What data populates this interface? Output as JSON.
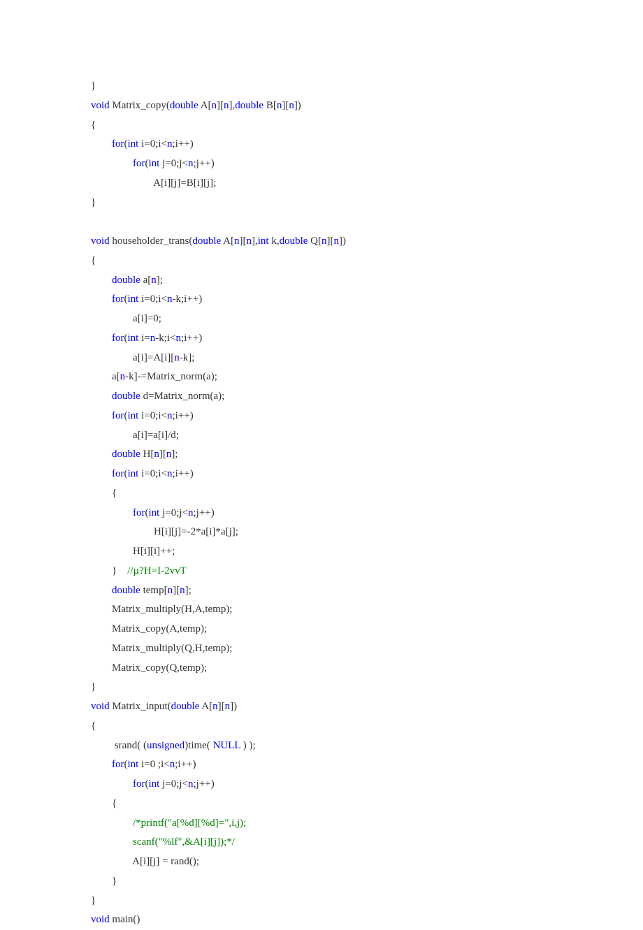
{
  "lines": [
    [
      {
        "c": "plain",
        "t": "}"
      }
    ],
    [
      {
        "c": "kw",
        "t": "void"
      },
      {
        "c": "plain",
        "t": " Matrix_copy("
      },
      {
        "c": "kw",
        "t": "double"
      },
      {
        "c": "plain",
        "t": " A["
      },
      {
        "c": "num",
        "t": "n"
      },
      {
        "c": "plain",
        "t": "]["
      },
      {
        "c": "num",
        "t": "n"
      },
      {
        "c": "plain",
        "t": "],"
      },
      {
        "c": "kw",
        "t": "double"
      },
      {
        "c": "plain",
        "t": " B["
      },
      {
        "c": "num",
        "t": "n"
      },
      {
        "c": "plain",
        "t": "]["
      },
      {
        "c": "num",
        "t": "n"
      },
      {
        "c": "plain",
        "t": "])"
      }
    ],
    [
      {
        "c": "plain",
        "t": "{"
      }
    ],
    [
      {
        "c": "plain",
        "t": "        "
      },
      {
        "c": "kw",
        "t": "for"
      },
      {
        "c": "plain",
        "t": "("
      },
      {
        "c": "kw",
        "t": "int"
      },
      {
        "c": "plain",
        "t": " i=0;i<"
      },
      {
        "c": "num",
        "t": "n"
      },
      {
        "c": "plain",
        "t": ";i++)"
      }
    ],
    [
      {
        "c": "plain",
        "t": "                "
      },
      {
        "c": "kw",
        "t": "for"
      },
      {
        "c": "plain",
        "t": "("
      },
      {
        "c": "kw",
        "t": "int"
      },
      {
        "c": "plain",
        "t": " j=0;j<"
      },
      {
        "c": "num",
        "t": "n"
      },
      {
        "c": "plain",
        "t": ";j++)"
      }
    ],
    [
      {
        "c": "plain",
        "t": "                        A[i][j]=B[i][j];"
      }
    ],
    [
      {
        "c": "plain",
        "t": "}"
      }
    ],
    [
      {
        "c": "plain",
        "t": ""
      }
    ],
    [
      {
        "c": "kw",
        "t": "void"
      },
      {
        "c": "plain",
        "t": " householder_trans("
      },
      {
        "c": "kw",
        "t": "double"
      },
      {
        "c": "plain",
        "t": " A["
      },
      {
        "c": "num",
        "t": "n"
      },
      {
        "c": "plain",
        "t": "]["
      },
      {
        "c": "num",
        "t": "n"
      },
      {
        "c": "plain",
        "t": "],"
      },
      {
        "c": "kw",
        "t": "int"
      },
      {
        "c": "plain",
        "t": " k,"
      },
      {
        "c": "kw",
        "t": "double"
      },
      {
        "c": "plain",
        "t": " Q["
      },
      {
        "c": "num",
        "t": "n"
      },
      {
        "c": "plain",
        "t": "]["
      },
      {
        "c": "num",
        "t": "n"
      },
      {
        "c": "plain",
        "t": "])"
      }
    ],
    [
      {
        "c": "plain",
        "t": "{"
      }
    ],
    [
      {
        "c": "plain",
        "t": "        "
      },
      {
        "c": "kw",
        "t": "double"
      },
      {
        "c": "plain",
        "t": " a["
      },
      {
        "c": "num",
        "t": "n"
      },
      {
        "c": "plain",
        "t": "];"
      }
    ],
    [
      {
        "c": "plain",
        "t": "        "
      },
      {
        "c": "kw",
        "t": "for"
      },
      {
        "c": "plain",
        "t": "("
      },
      {
        "c": "kw",
        "t": "int"
      },
      {
        "c": "plain",
        "t": " i=0;i<"
      },
      {
        "c": "num",
        "t": "n"
      },
      {
        "c": "plain",
        "t": "-k;i++)"
      }
    ],
    [
      {
        "c": "plain",
        "t": "                a[i]=0;"
      }
    ],
    [
      {
        "c": "plain",
        "t": "        "
      },
      {
        "c": "kw",
        "t": "for"
      },
      {
        "c": "plain",
        "t": "("
      },
      {
        "c": "kw",
        "t": "int"
      },
      {
        "c": "plain",
        "t": " i="
      },
      {
        "c": "num",
        "t": "n"
      },
      {
        "c": "plain",
        "t": "-k;i<"
      },
      {
        "c": "num",
        "t": "n"
      },
      {
        "c": "plain",
        "t": ";i++)"
      }
    ],
    [
      {
        "c": "plain",
        "t": "                a[i]=A[i]["
      },
      {
        "c": "num",
        "t": "n"
      },
      {
        "c": "plain",
        "t": "-k];"
      }
    ],
    [
      {
        "c": "plain",
        "t": "        a["
      },
      {
        "c": "num",
        "t": "n"
      },
      {
        "c": "plain",
        "t": "-k]-=Matrix_norm(a);"
      }
    ],
    [
      {
        "c": "plain",
        "t": "        "
      },
      {
        "c": "kw",
        "t": "double"
      },
      {
        "c": "plain",
        "t": " d=Matrix_norm(a);"
      }
    ],
    [
      {
        "c": "plain",
        "t": "        "
      },
      {
        "c": "kw",
        "t": "for"
      },
      {
        "c": "plain",
        "t": "("
      },
      {
        "c": "kw",
        "t": "int"
      },
      {
        "c": "plain",
        "t": " i=0;i<"
      },
      {
        "c": "num",
        "t": "n"
      },
      {
        "c": "plain",
        "t": ";i++)"
      }
    ],
    [
      {
        "c": "plain",
        "t": "                a[i]=a[i]/d;"
      }
    ],
    [
      {
        "c": "plain",
        "t": "        "
      },
      {
        "c": "kw",
        "t": "double"
      },
      {
        "c": "plain",
        "t": " H["
      },
      {
        "c": "num",
        "t": "n"
      },
      {
        "c": "plain",
        "t": "]["
      },
      {
        "c": "num",
        "t": "n"
      },
      {
        "c": "plain",
        "t": "];"
      }
    ],
    [
      {
        "c": "plain",
        "t": "        "
      },
      {
        "c": "kw",
        "t": "for"
      },
      {
        "c": "plain",
        "t": "("
      },
      {
        "c": "kw",
        "t": "int"
      },
      {
        "c": "plain",
        "t": " i=0;i<"
      },
      {
        "c": "num",
        "t": "n"
      },
      {
        "c": "plain",
        "t": ";i++)"
      }
    ],
    [
      {
        "c": "plain",
        "t": "        {"
      }
    ],
    [
      {
        "c": "plain",
        "t": "                "
      },
      {
        "c": "kw",
        "t": "for"
      },
      {
        "c": "plain",
        "t": "("
      },
      {
        "c": "kw",
        "t": "int"
      },
      {
        "c": "plain",
        "t": " j=0;j<"
      },
      {
        "c": "num",
        "t": "n"
      },
      {
        "c": "plain",
        "t": ";j++)"
      }
    ],
    [
      {
        "c": "plain",
        "t": "                        H[i][j]=-2*a[i]*a[j];"
      }
    ],
    [
      {
        "c": "plain",
        "t": "                H[i][i]++;"
      }
    ],
    [
      {
        "c": "plain",
        "t": "        }    "
      },
      {
        "c": "com",
        "t": "//µ?H=I-2vvT"
      }
    ],
    [
      {
        "c": "plain",
        "t": "        "
      },
      {
        "c": "kw",
        "t": "double"
      },
      {
        "c": "plain",
        "t": " temp["
      },
      {
        "c": "num",
        "t": "n"
      },
      {
        "c": "plain",
        "t": "]["
      },
      {
        "c": "num",
        "t": "n"
      },
      {
        "c": "plain",
        "t": "];"
      }
    ],
    [
      {
        "c": "plain",
        "t": "        Matrix_multiply(H,A,temp);"
      }
    ],
    [
      {
        "c": "plain",
        "t": "        Matrix_copy(A,temp);"
      }
    ],
    [
      {
        "c": "plain",
        "t": "        Matrix_multiply(Q,H,temp);"
      }
    ],
    [
      {
        "c": "plain",
        "t": "        Matrix_copy(Q,temp);"
      }
    ],
    [
      {
        "c": "plain",
        "t": "}"
      }
    ],
    [
      {
        "c": "kw",
        "t": "void"
      },
      {
        "c": "plain",
        "t": " Matrix_input("
      },
      {
        "c": "kw",
        "t": "double"
      },
      {
        "c": "plain",
        "t": " A["
      },
      {
        "c": "num",
        "t": "n"
      },
      {
        "c": "plain",
        "t": "]["
      },
      {
        "c": "num",
        "t": "n"
      },
      {
        "c": "plain",
        "t": "])"
      }
    ],
    [
      {
        "c": "plain",
        "t": "{"
      }
    ],
    [
      {
        "c": "plain",
        "t": "         srand( ("
      },
      {
        "c": "kw",
        "t": "unsigned"
      },
      {
        "c": "plain",
        "t": ")time( "
      },
      {
        "c": "num",
        "t": "NULL"
      },
      {
        "c": "plain",
        "t": " ) );"
      }
    ],
    [
      {
        "c": "plain",
        "t": "        "
      },
      {
        "c": "kw",
        "t": "for"
      },
      {
        "c": "plain",
        "t": "("
      },
      {
        "c": "kw",
        "t": "int"
      },
      {
        "c": "plain",
        "t": " i=0 ;i<"
      },
      {
        "c": "num",
        "t": "n"
      },
      {
        "c": "plain",
        "t": ";i++)"
      }
    ],
    [
      {
        "c": "plain",
        "t": "                "
      },
      {
        "c": "kw",
        "t": "for"
      },
      {
        "c": "plain",
        "t": "("
      },
      {
        "c": "kw",
        "t": "int"
      },
      {
        "c": "plain",
        "t": " j=0;j<"
      },
      {
        "c": "num",
        "t": "n"
      },
      {
        "c": "plain",
        "t": ";j++)"
      }
    ],
    [
      {
        "c": "plain",
        "t": "        {"
      }
    ],
    [
      {
        "c": "plain",
        "t": "                "
      },
      {
        "c": "com",
        "t": "/*printf(\"a[%d][%d]=\",i,j);"
      }
    ],
    [
      {
        "c": "plain",
        "t": "                "
      },
      {
        "c": "com",
        "t": "scanf(\"%lf\",&A[i][j]);*/"
      }
    ],
    [
      {
        "c": "plain",
        "t": "                A[i][j] = rand();"
      }
    ],
    [
      {
        "c": "plain",
        "t": "        }"
      }
    ],
    [
      {
        "c": "plain",
        "t": "}"
      }
    ],
    [
      {
        "c": "kw",
        "t": "void"
      },
      {
        "c": "plain",
        "t": " main()"
      }
    ]
  ]
}
